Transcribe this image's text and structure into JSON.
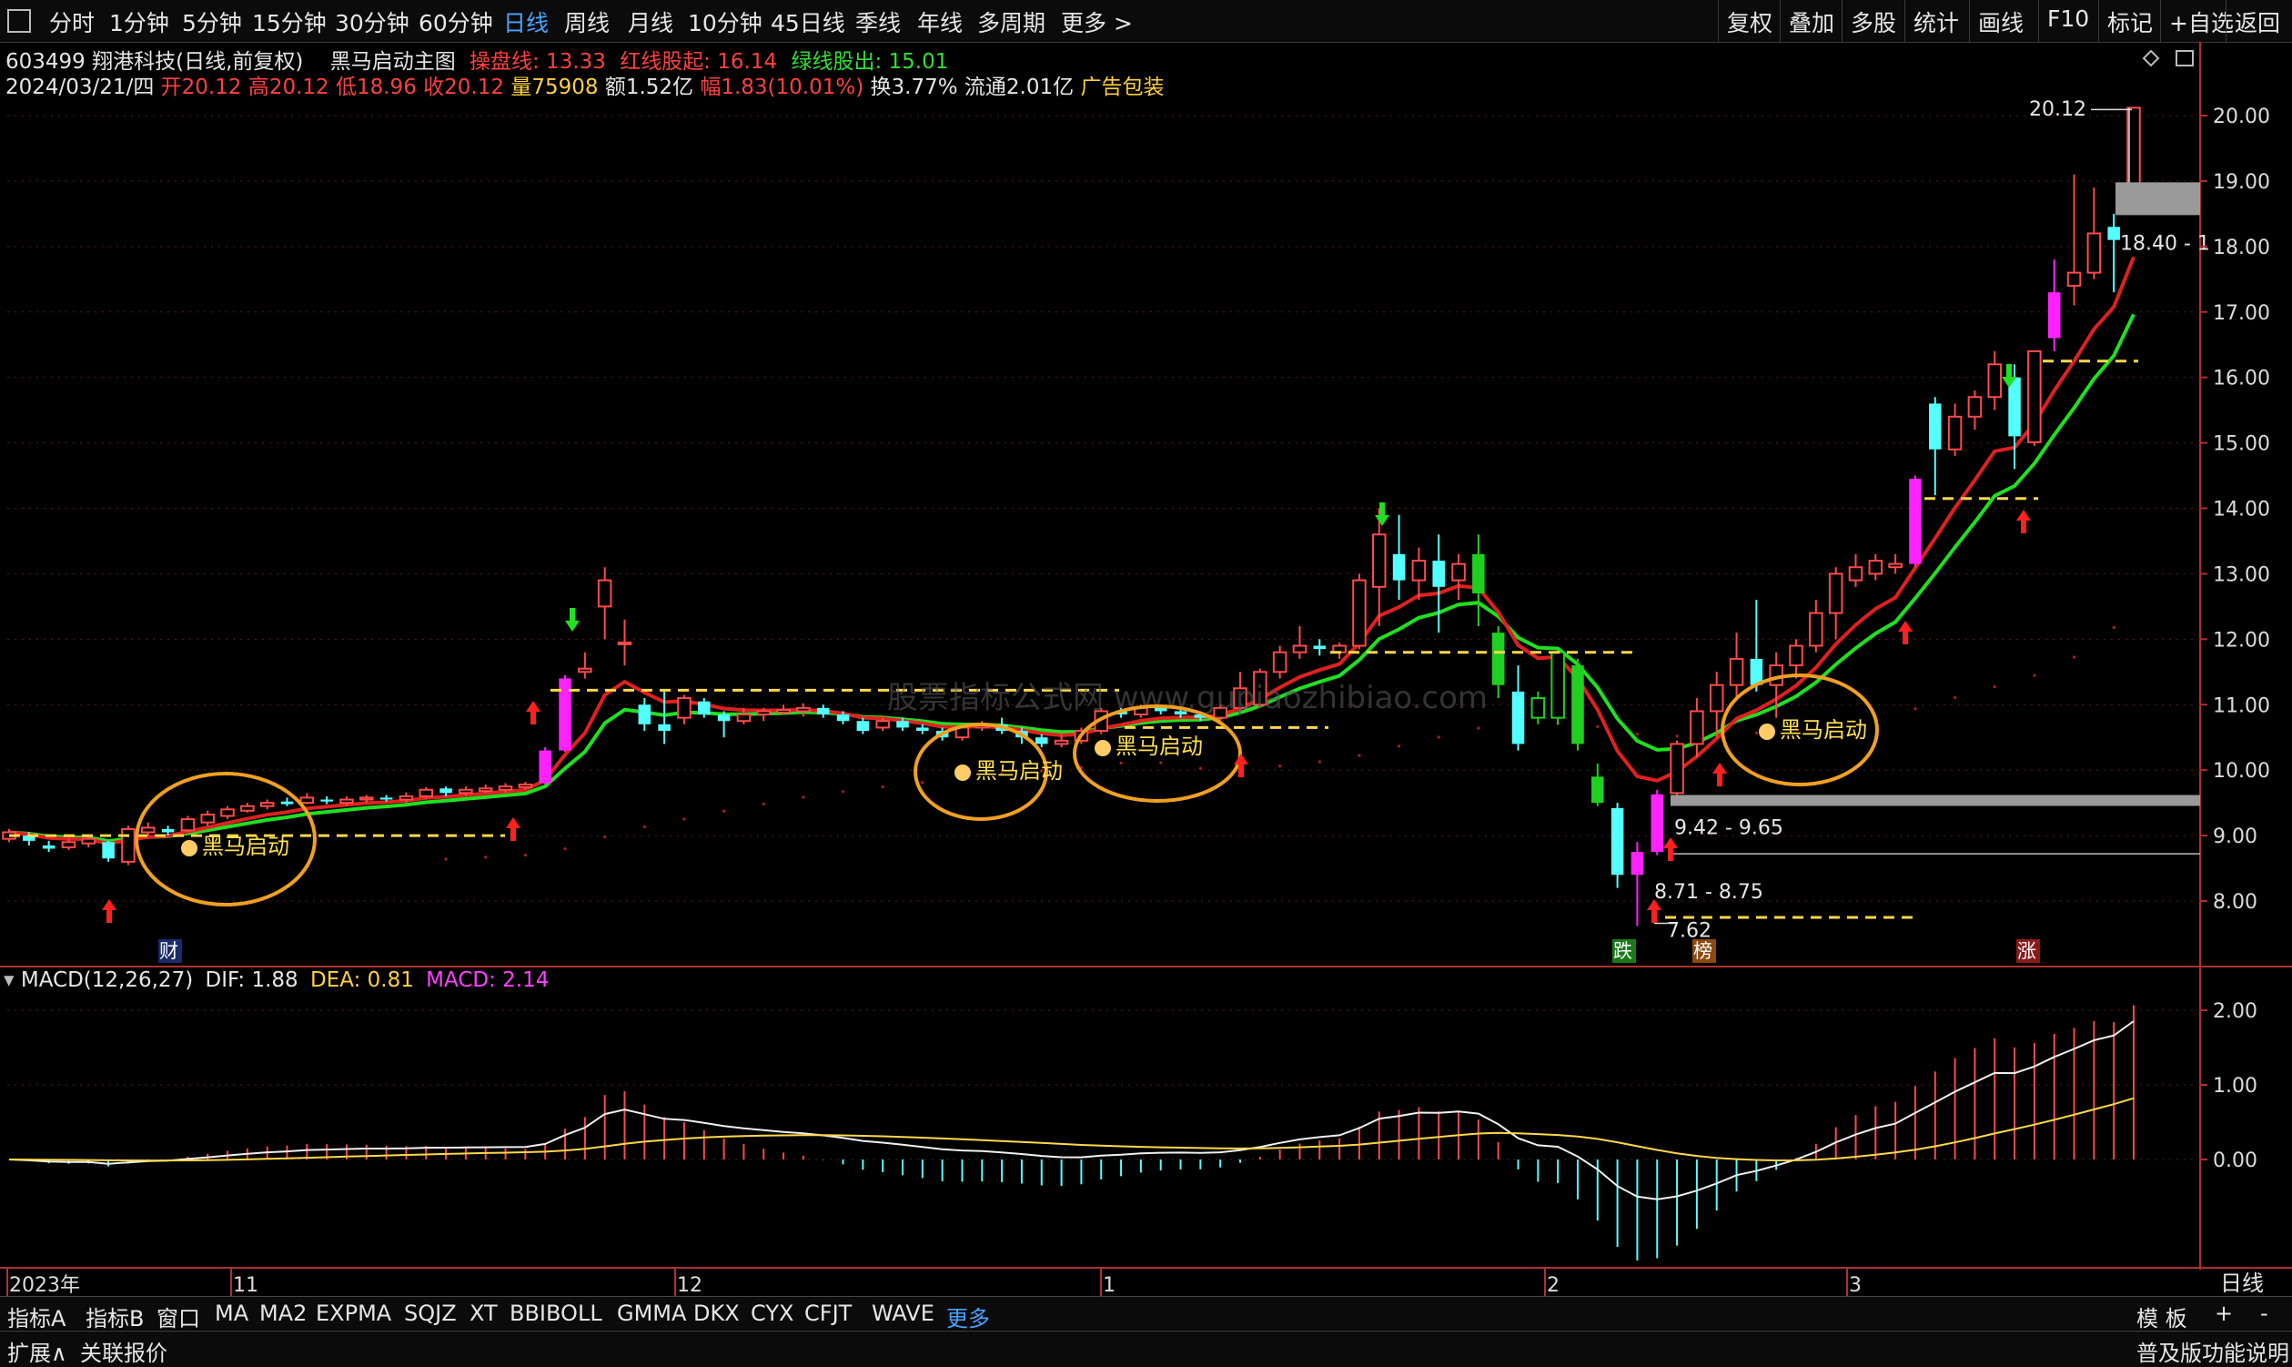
{
  "toolbar": {
    "periods": [
      "分时",
      "1分钟",
      "5分钟",
      "15分钟",
      "30分钟",
      "60分钟",
      "日线",
      "周线",
      "月线",
      "10分钟",
      "45日线",
      "季线",
      "年线",
      "多周期",
      "更多 >"
    ],
    "active_period": "日线",
    "right_buttons": [
      "复权",
      "叠加",
      "多股",
      "统计",
      "画线",
      "F10",
      "标记",
      "+自选",
      "返回"
    ]
  },
  "info_line1": {
    "stock": "603499 翔港科技(日线,前复权)",
    "indicator_name": "黑马启动主图",
    "cao_pan_xian": "操盘线: 13.33",
    "hong_xian": "红线股起: 16.14",
    "lv_xian": "绿线股出: 15.01"
  },
  "info_line2": {
    "date": "2024/03/21/四",
    "open": "开20.12",
    "high": "高20.12",
    "low": "低18.96",
    "close": "收20.12",
    "volume": "量75908",
    "amount": "额1.52亿",
    "change": "幅1.83(10.01%)",
    "turnover": "换3.77%",
    "float": "流通2.01亿",
    "ad": "广告包装"
  },
  "price_axis": [
    "20.00",
    "19.00",
    "18.00",
    "17.00",
    "16.00",
    "15.00",
    "14.00",
    "13.00",
    "12.00",
    "11.00",
    "10.00",
    "9.00",
    "8.00"
  ],
  "macd_axis": [
    "2.00",
    "1.00",
    "0.00"
  ],
  "annotations": {
    "max_price": "20.12",
    "range_label_top": "18.40 - 1",
    "range_1": "9.42 - 9.65",
    "range_2": "8.71 - 8.75",
    "min_price": "7.62",
    "callout": "黑马启动",
    "tag_cai": "财",
    "tag_die": "跌",
    "tag_bang": "榜",
    "tag_zhang": "涨",
    "watermark": "股票指标公式网 www.gupiaozhibiao.com"
  },
  "macd_info": {
    "name": "MACD(12,26,27)",
    "dif": "DIF: 1.88",
    "dea": "DEA: 0.81",
    "macd": "MACD: 2.14"
  },
  "time_axis": [
    "2023年",
    "11",
    "12",
    "1",
    "2",
    "3"
  ],
  "bottom_tabs": [
    "指标A",
    "指标B",
    "窗口",
    "MA",
    "MA2",
    "EXPMA",
    "SQJZ",
    "XT",
    "BBIBOLL",
    "GMMA",
    "DKX",
    "CYX",
    "CFJT",
    "WAVE",
    "更多"
  ],
  "bottom_right": [
    "模 板",
    "+",
    "-"
  ],
  "period_label": "日线",
  "status_left": [
    "扩展∧",
    "关联报价"
  ],
  "status_right": "普及版功能说明",
  "chart_data": {
    "type": "candlestick",
    "price_range": [
      7.3,
      20.5
    ],
    "candles": [
      {
        "o": 8.95,
        "c": 9.05,
        "h": 9.1,
        "l": 8.9
      },
      {
        "o": 9.0,
        "c": 8.92,
        "h": 9.05,
        "l": 8.85
      },
      {
        "o": 8.85,
        "c": 8.8,
        "h": 8.92,
        "l": 8.75
      },
      {
        "o": 8.82,
        "c": 8.9,
        "h": 8.95,
        "l": 8.78
      },
      {
        "o": 8.88,
        "c": 8.95,
        "h": 8.98,
        "l": 8.82
      },
      {
        "o": 8.9,
        "c": 8.65,
        "h": 8.92,
        "l": 8.6
      },
      {
        "o": 8.6,
        "c": 9.1,
        "h": 9.15,
        "l": 8.55
      },
      {
        "o": 9.05,
        "c": 9.12,
        "h": 9.2,
        "l": 9.0
      },
      {
        "o": 9.1,
        "c": 9.05,
        "h": 9.15,
        "l": 9.0
      },
      {
        "o": 9.08,
        "c": 9.25,
        "h": 9.3,
        "l": 9.05
      },
      {
        "o": 9.2,
        "c": 9.32,
        "h": 9.38,
        "l": 9.15
      },
      {
        "o": 9.3,
        "c": 9.4,
        "h": 9.45,
        "l": 9.25
      },
      {
        "o": 9.38,
        "c": 9.45,
        "h": 9.5,
        "l": 9.35
      },
      {
        "o": 9.45,
        "c": 9.5,
        "h": 9.55,
        "l": 9.4
      },
      {
        "o": 9.52,
        "c": 9.48,
        "h": 9.58,
        "l": 9.45
      },
      {
        "o": 9.5,
        "c": 9.58,
        "h": 9.65,
        "l": 9.48
      },
      {
        "o": 9.55,
        "c": 9.52,
        "h": 9.6,
        "l": 9.48
      },
      {
        "o": 9.5,
        "c": 9.55,
        "h": 9.6,
        "l": 9.45
      },
      {
        "o": 9.55,
        "c": 9.58,
        "h": 9.62,
        "l": 9.5
      },
      {
        "o": 9.58,
        "c": 9.55,
        "h": 9.62,
        "l": 9.52
      },
      {
        "o": 9.55,
        "c": 9.6,
        "h": 9.66,
        "l": 9.5
      },
      {
        "o": 9.6,
        "c": 9.7,
        "h": 9.74,
        "l": 9.56
      },
      {
        "o": 9.72,
        "c": 9.65,
        "h": 9.75,
        "l": 9.6
      },
      {
        "o": 9.65,
        "c": 9.7,
        "h": 9.75,
        "l": 9.6
      },
      {
        "o": 9.68,
        "c": 9.72,
        "h": 9.78,
        "l": 9.65
      },
      {
        "o": 9.7,
        "c": 9.75,
        "h": 9.8,
        "l": 9.65
      },
      {
        "o": 9.74,
        "c": 9.78,
        "h": 9.82,
        "l": 9.7
      },
      {
        "o": 9.8,
        "c": 10.3,
        "h": 10.35,
        "l": 9.78
      },
      {
        "o": 10.3,
        "c": 11.4,
        "h": 11.45,
        "l": 10.28
      },
      {
        "o": 11.5,
        "c": 11.55,
        "h": 11.8,
        "l": 11.4
      },
      {
        "o": 12.5,
        "c": 12.9,
        "h": 13.1,
        "l": 12.0
      },
      {
        "o": 11.95,
        "c": 11.95,
        "h": 12.3,
        "l": 11.6
      },
      {
        "o": 11.0,
        "c": 10.7,
        "h": 11.1,
        "l": 10.6
      },
      {
        "o": 10.7,
        "c": 10.6,
        "h": 11.2,
        "l": 10.4
      },
      {
        "o": 10.8,
        "c": 11.1,
        "h": 11.15,
        "l": 10.7
      },
      {
        "o": 11.05,
        "c": 10.85,
        "h": 11.1,
        "l": 10.8
      },
      {
        "o": 10.85,
        "c": 10.75,
        "h": 10.9,
        "l": 10.5
      },
      {
        "o": 10.75,
        "c": 10.85,
        "h": 10.95,
        "l": 10.7
      },
      {
        "o": 10.85,
        "c": 10.9,
        "h": 10.95,
        "l": 10.75
      },
      {
        "o": 10.88,
        "c": 10.92,
        "h": 11.0,
        "l": 10.85
      },
      {
        "o": 10.9,
        "c": 10.95,
        "h": 11.02,
        "l": 10.82
      },
      {
        "o": 10.95,
        "c": 10.85,
        "h": 11.0,
        "l": 10.8
      },
      {
        "o": 10.85,
        "c": 10.75,
        "h": 10.9,
        "l": 10.7
      },
      {
        "o": 10.75,
        "c": 10.6,
        "h": 10.8,
        "l": 10.55
      },
      {
        "o": 10.65,
        "c": 10.75,
        "h": 10.8,
        "l": 10.6
      },
      {
        "o": 10.75,
        "c": 10.65,
        "h": 10.8,
        "l": 10.6
      },
      {
        "o": 10.65,
        "c": 10.6,
        "h": 10.7,
        "l": 10.55
      },
      {
        "o": 10.6,
        "c": 10.5,
        "h": 10.65,
        "l": 10.45
      },
      {
        "o": 10.5,
        "c": 10.65,
        "h": 10.7,
        "l": 10.45
      },
      {
        "o": 10.65,
        "c": 10.7,
        "h": 10.75,
        "l": 10.6
      },
      {
        "o": 10.7,
        "c": 10.6,
        "h": 10.8,
        "l": 10.55
      },
      {
        "o": 10.6,
        "c": 10.5,
        "h": 10.65,
        "l": 10.4
      },
      {
        "o": 10.5,
        "c": 10.4,
        "h": 10.55,
        "l": 10.35
      },
      {
        "o": 10.4,
        "c": 10.45,
        "h": 10.55,
        "l": 10.35
      },
      {
        "o": 10.45,
        "c": 10.6,
        "h": 10.65,
        "l": 10.4
      },
      {
        "o": 10.6,
        "c": 10.9,
        "h": 10.95,
        "l": 10.55
      },
      {
        "o": 10.9,
        "c": 10.85,
        "h": 10.95,
        "l": 10.8
      },
      {
        "o": 10.85,
        "c": 10.95,
        "h": 11.0,
        "l": 10.8
      },
      {
        "o": 10.95,
        "c": 10.9,
        "h": 11.0,
        "l": 10.85
      },
      {
        "o": 10.9,
        "c": 10.85,
        "h": 10.95,
        "l": 10.8
      },
      {
        "o": 10.85,
        "c": 10.8,
        "h": 10.9,
        "l": 10.75
      },
      {
        "o": 10.8,
        "c": 10.95,
        "h": 11.0,
        "l": 10.75
      },
      {
        "o": 10.95,
        "c": 11.25,
        "h": 11.5,
        "l": 10.9
      },
      {
        "o": 11.0,
        "c": 11.5,
        "h": 11.55,
        "l": 10.95
      },
      {
        "o": 11.5,
        "c": 11.8,
        "h": 11.9,
        "l": 11.4
      },
      {
        "o": 11.8,
        "c": 11.9,
        "h": 12.2,
        "l": 11.7
      },
      {
        "o": 11.9,
        "c": 11.85,
        "h": 12.0,
        "l": 11.75
      },
      {
        "o": 11.8,
        "c": 11.9,
        "h": 11.95,
        "l": 11.7
      },
      {
        "o": 11.9,
        "c": 12.9,
        "h": 13.0,
        "l": 11.85
      },
      {
        "o": 12.8,
        "c": 13.6,
        "h": 14.0,
        "l": 12.2
      },
      {
        "o": 13.3,
        "c": 12.9,
        "h": 13.9,
        "l": 12.6
      },
      {
        "o": 12.9,
        "c": 13.2,
        "h": 13.4,
        "l": 12.6
      },
      {
        "o": 13.2,
        "c": 12.8,
        "h": 13.6,
        "l": 12.1
      },
      {
        "o": 12.9,
        "c": 13.15,
        "h": 13.3,
        "l": 12.6
      },
      {
        "o": 13.3,
        "c": 12.7,
        "h": 13.6,
        "l": 12.2
      },
      {
        "o": 12.1,
        "c": 11.3,
        "h": 12.2,
        "l": 11.1
      },
      {
        "o": 11.2,
        "c": 10.4,
        "h": 11.6,
        "l": 10.3
      },
      {
        "o": 10.8,
        "c": 11.1,
        "h": 11.2,
        "l": 10.7
      },
      {
        "o": 10.8,
        "c": 11.8,
        "h": 11.85,
        "l": 10.7
      },
      {
        "o": 11.6,
        "c": 10.4,
        "h": 11.7,
        "l": 10.3
      },
      {
        "o": 9.9,
        "c": 9.5,
        "h": 10.1,
        "l": 9.45
      },
      {
        "o": 9.42,
        "c": 8.4,
        "h": 9.5,
        "l": 8.2
      },
      {
        "o": 8.4,
        "c": 8.75,
        "h": 8.9,
        "l": 7.62
      },
      {
        "o": 8.75,
        "c": 9.63,
        "h": 9.7,
        "l": 8.7
      },
      {
        "o": 9.65,
        "c": 10.4,
        "h": 10.45,
        "l": 9.5
      },
      {
        "o": 10.4,
        "c": 10.9,
        "h": 11.1,
        "l": 10.2
      },
      {
        "o": 10.9,
        "c": 11.3,
        "h": 11.5,
        "l": 10.5
      },
      {
        "o": 11.3,
        "c": 11.7,
        "h": 12.1,
        "l": 11.1
      },
      {
        "o": 11.7,
        "c": 11.3,
        "h": 12.6,
        "l": 11.2
      },
      {
        "o": 11.3,
        "c": 11.6,
        "h": 11.8,
        "l": 10.8
      },
      {
        "o": 11.6,
        "c": 11.9,
        "h": 12.0,
        "l": 11.4
      },
      {
        "o": 11.9,
        "c": 12.4,
        "h": 12.6,
        "l": 11.8
      },
      {
        "o": 12.4,
        "c": 13.0,
        "h": 13.1,
        "l": 12.0
      },
      {
        "o": 12.9,
        "c": 13.1,
        "h": 13.3,
        "l": 12.8
      },
      {
        "o": 13.0,
        "c": 13.2,
        "h": 13.3,
        "l": 12.9
      },
      {
        "o": 13.1,
        "c": 13.15,
        "h": 13.3,
        "l": 13.0
      },
      {
        "o": 13.15,
        "c": 14.45,
        "h": 14.5,
        "l": 13.1
      },
      {
        "o": 15.6,
        "c": 14.9,
        "h": 15.7,
        "l": 14.2
      },
      {
        "o": 14.9,
        "c": 15.4,
        "h": 15.6,
        "l": 14.8
      },
      {
        "o": 15.4,
        "c": 15.7,
        "h": 15.8,
        "l": 15.2
      },
      {
        "o": 15.7,
        "c": 16.2,
        "h": 16.4,
        "l": 15.5
      },
      {
        "o": 16.0,
        "c": 15.1,
        "h": 16.2,
        "l": 14.6
      },
      {
        "o": 15.01,
        "c": 16.4,
        "h": 16.4,
        "l": 14.95
      },
      {
        "o": 16.6,
        "c": 17.3,
        "h": 17.8,
        "l": 16.4
      },
      {
        "o": 17.4,
        "c": 17.6,
        "h": 19.1,
        "l": 17.1
      },
      {
        "o": 17.6,
        "c": 18.2,
        "h": 18.9,
        "l": 17.5
      },
      {
        "o": 18.3,
        "c": 18.1,
        "h": 18.5,
        "l": 17.3
      },
      {
        "o": 18.96,
        "c": 20.12,
        "h": 20.12,
        "l": 18.96
      }
    ]
  }
}
